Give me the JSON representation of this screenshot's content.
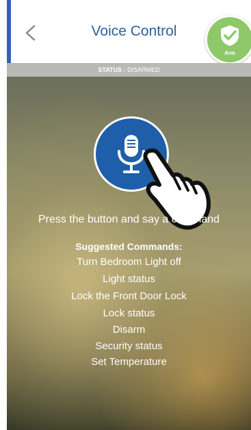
{
  "header": {
    "back_icon": "chevron-left-icon",
    "title": "Voice Control",
    "arm_label": "Arm",
    "arm_icon": "shield-check-icon",
    "accent_color": "#2f66b3",
    "arm_color": "#8ec868"
  },
  "status": {
    "label": "STATUS :",
    "value": "DISARMED"
  },
  "main": {
    "mic_icon": "microphone-icon",
    "hand_icon": "pointing-hand-icon",
    "button_color": "#1f5ea9",
    "prompt": "Press the button and say a command",
    "suggested_title": "Suggested Commands:",
    "commands": [
      "Turn Bedroom Light off",
      "Light status",
      "Lock the Front Door Lock",
      "Lock status",
      "Disarm",
      "Security status",
      "Set Temperature"
    ]
  }
}
